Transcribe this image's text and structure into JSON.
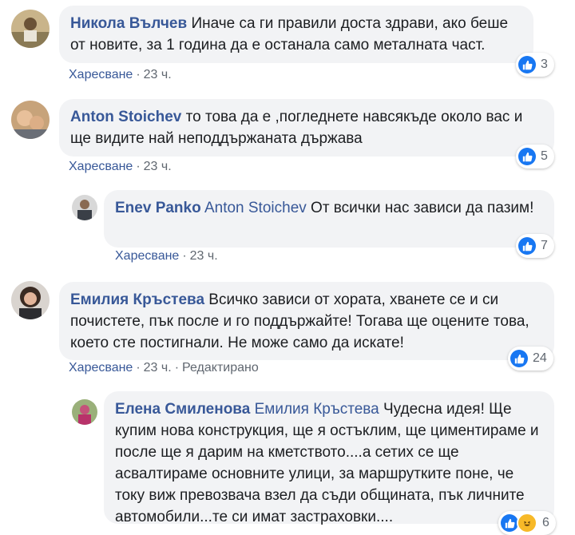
{
  "comments": [
    {
      "author": "Никола Вълчев",
      "text": "Иначе са ги правили доста здрави, ако беше от новите, за 1 година да е останала само металната част.",
      "like_label": "Харесване",
      "time": "23 ч.",
      "reactions": "3"
    },
    {
      "author": "Anton Stoichev",
      "text": "то това да е ,погледнете навсякъде около вас и ще видите най неподдържаната държава",
      "like_label": "Харесване",
      "time": "23 ч.",
      "reactions": "5"
    },
    {
      "author": "Enev Panko",
      "mention": "Anton Stoichev",
      "text": "От всички нас зависи да пазим!",
      "like_label": "Харесване",
      "time": "23 ч.",
      "reactions": "7"
    },
    {
      "author": "Емилия Кръстева",
      "text": "Всичко зависи от хората, хванете се и си почистете, пък после и го поддържайте! Тогава ще оцените това, което сте постигнали. Не може само да искате!",
      "like_label": "Харесване",
      "time": "23 ч.",
      "edited": "Редактирано",
      "reactions": "24"
    },
    {
      "author": "Елена Смиленова",
      "mention": "Емилия Кръстева",
      "text": "Чудесна идея! Ще купим нова конструкция, ще я остъклим, ще циментираме и после ще я дарим на кметството....а сетих се ще асвалтираме основните улици, за маршрутките поне, че току виж превозвача взел да съди общината, пък личните автомобили...те си имат застраховки....",
      "reactions": "6"
    }
  ],
  "colors": {
    "author": "#385898",
    "bubble": "#f2f3f5",
    "meta": "#606770",
    "like_badge": "#1877f2",
    "haha_badge": "#f7b928"
  },
  "icons": {
    "like": "thumbs-up-icon",
    "haha": "laughing-face-icon"
  }
}
